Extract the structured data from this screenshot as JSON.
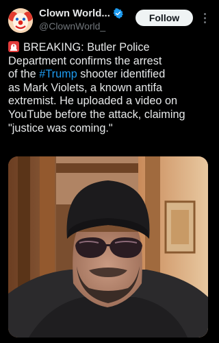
{
  "post": {
    "author": {
      "display_name": "Clown World...",
      "handle": "@ClownWorld_",
      "avatar_icon": "clown-avatar-icon",
      "verified_icon": "verified-badge-icon",
      "verified_color": "#1d9bf0"
    },
    "follow_label": "Follow",
    "more_icon": "more-options-icon",
    "text_lines": [
      {
        "before": "BREAKING: Butler Police",
        "hashtag": "",
        "after": ""
      },
      {
        "before": "Department confirms the arrest",
        "hashtag": "",
        "after": ""
      },
      {
        "before": "of the ",
        "hashtag": "#Trump",
        "after": " shooter identified"
      },
      {
        "before": "as Mark Violets, a known antifa",
        "hashtag": "",
        "after": ""
      },
      {
        "before": "extremist. He uploaded a video on",
        "hashtag": "",
        "after": ""
      },
      {
        "before": "YouTube before the attack, claiming",
        "hashtag": "",
        "after": ""
      },
      {
        "before": "\"justice was coming.\"",
        "hashtag": "",
        "after": ""
      }
    ],
    "leading_icon": "siren-icon",
    "media": {
      "type": "photo",
      "subject": "man-in-beanie-and-sunglasses"
    }
  },
  "colors": {
    "background": "#000000",
    "text": "#e7e9ea",
    "secondary": "#71767b",
    "link": "#1d9bf0",
    "follow_bg": "#eff3f4"
  }
}
